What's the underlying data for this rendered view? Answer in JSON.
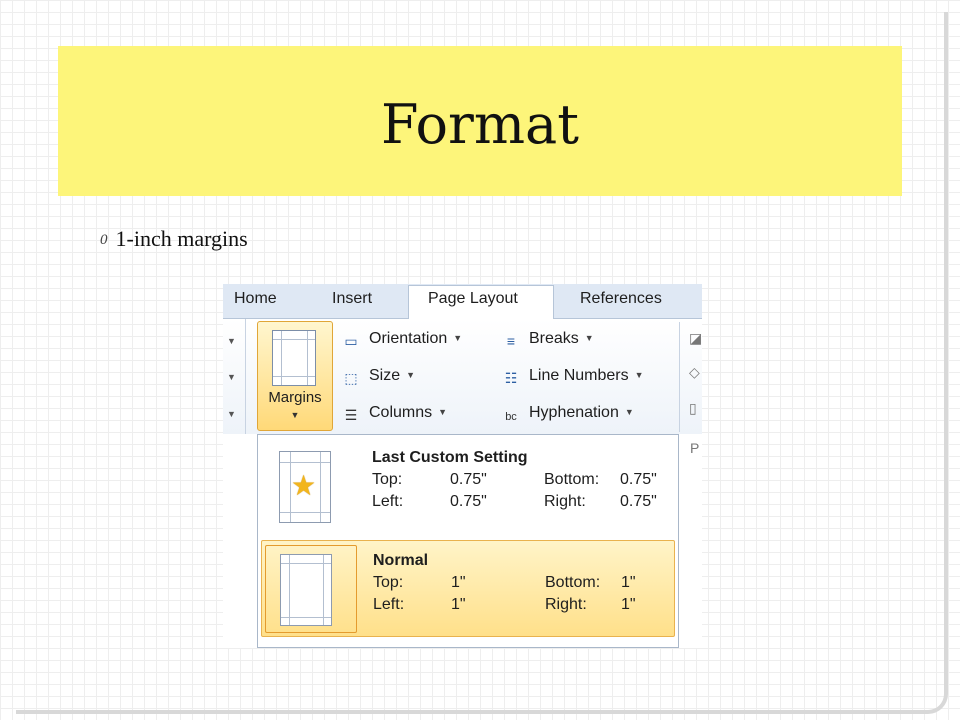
{
  "slide": {
    "title": "Format",
    "bullet_number": "0",
    "bullet_text": "1-inch margins"
  },
  "ribbon": {
    "tabs": [
      "Home",
      "Insert",
      "Page Layout",
      "References"
    ],
    "active_tab": "Page Layout",
    "margins_label": "Margins",
    "commands": {
      "orientation": "Orientation",
      "size": "Size",
      "columns": "Columns",
      "breaks": "Breaks",
      "line_numbers": "Line Numbers",
      "hyphenation": "Hyphenation"
    },
    "right_edge_letter": "P"
  },
  "margins_menu": {
    "options": [
      {
        "name": "Last Custom Setting",
        "icon": "star-icon",
        "top_label": "Top:",
        "top": "0.75\"",
        "bottom_label": "Bottom:",
        "bottom": "0.75\"",
        "left_label": "Left:",
        "left": "0.75\"",
        "right_label": "Right:",
        "right": "0.75\"",
        "selected": false
      },
      {
        "name": "Normal",
        "top_label": "Top:",
        "top": "1\"",
        "bottom_label": "Bottom:",
        "bottom": "1\"",
        "left_label": "Left:",
        "left": "1\"",
        "right_label": "Right:",
        "right": "1\"",
        "selected": true
      }
    ]
  },
  "colors": {
    "title_band": "#fdf57a",
    "selection_fill": "#ffe08a",
    "selection_border": "#e9b24e"
  }
}
